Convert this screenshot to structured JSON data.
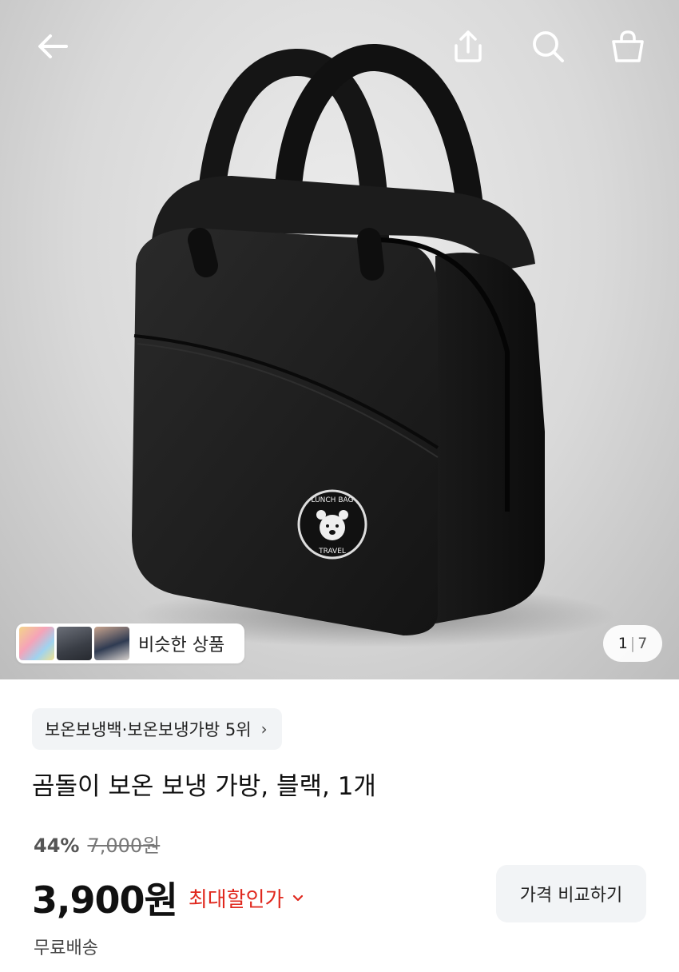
{
  "header": {
    "back_icon": "arrow-left-icon",
    "share_icon": "share-icon",
    "search_icon": "search-icon",
    "cart_icon": "shopping-bag-icon"
  },
  "gallery": {
    "similar_products_label": "비슷한 상품",
    "current_page": "1",
    "total_pages": "7",
    "bag_badge_top": "LUNCH BAG",
    "bag_badge_bottom": "TRAVEL"
  },
  "product": {
    "category_rank": "보온보냉백·보온보냉가방 5위",
    "title": "곰돌이 보온 보냉 가방, 블랙, 1개",
    "discount_rate": "44%",
    "original_price": "7,000원",
    "price": "3,900원",
    "max_discount_label": "최대할인가",
    "compare_button": "가격 비교하기",
    "shipping": "무료배송"
  },
  "colors": {
    "accent_red": "#e0281e",
    "chip_bg": "#f2f4f6"
  }
}
